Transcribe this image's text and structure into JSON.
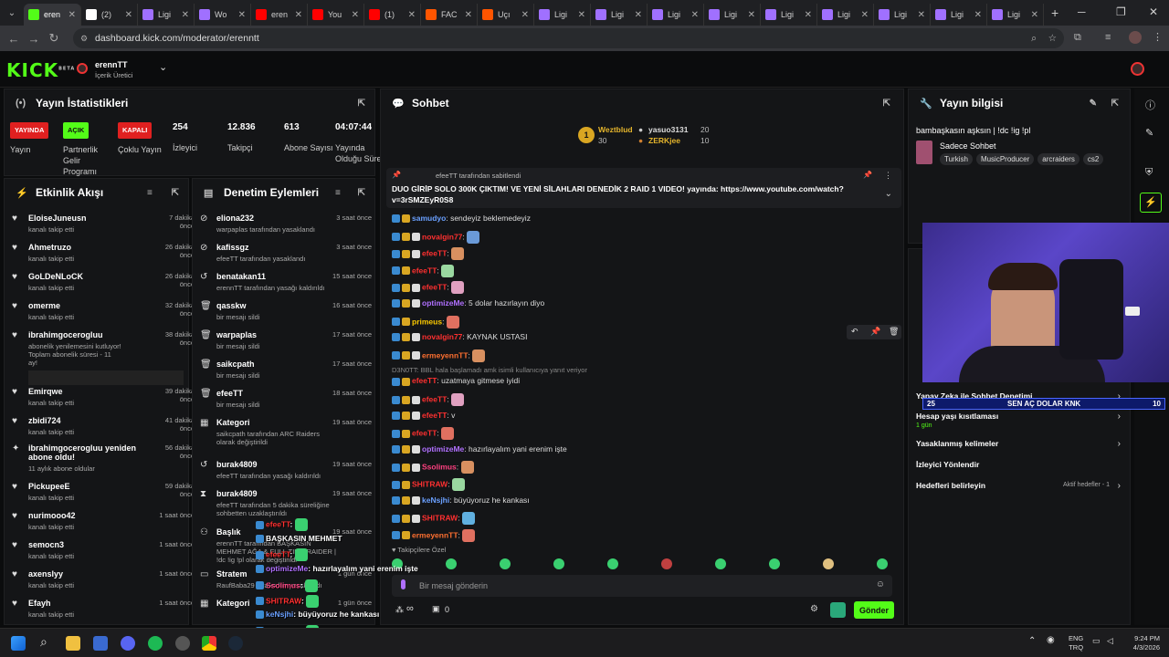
{
  "tabs": [
    {
      "label": "eren",
      "color": "#53fc18",
      "active": true
    },
    {
      "label": "(2)",
      "color": "#ffffff"
    },
    {
      "label": "Ligi",
      "color": "#a070ff"
    },
    {
      "label": "Wo",
      "color": "#a070ff"
    },
    {
      "label": "eren",
      "color": "#ff0000"
    },
    {
      "label": "You",
      "color": "#ff0000"
    },
    {
      "label": "(1)",
      "color": "#ff0000"
    },
    {
      "label": "FAC",
      "color": "#ff5500"
    },
    {
      "label": "Uçı",
      "color": "#ff5500"
    },
    {
      "label": "Ligi",
      "color": "#a070ff"
    },
    {
      "label": "Ligi",
      "color": "#a070ff"
    },
    {
      "label": "Ligi",
      "color": "#a070ff"
    },
    {
      "label": "Ligi",
      "color": "#a070ff"
    },
    {
      "label": "Ligi",
      "color": "#a070ff"
    },
    {
      "label": "Ligi",
      "color": "#a070ff"
    },
    {
      "label": "Ligi",
      "color": "#a070ff"
    },
    {
      "label": "Ligi",
      "color": "#a070ff"
    },
    {
      "label": "Ligi",
      "color": "#a070ff"
    }
  ],
  "browser": {
    "url": "dashboard.kick.com/moderator/erenntt"
  },
  "header": {
    "logo": "KICK",
    "beta": "BETA",
    "channel_name": "erennTT",
    "channel_role": "İçerik Üretici"
  },
  "stats": {
    "title": "Yayın İstatistikleri",
    "items": [
      {
        "badge": "YAYINDA",
        "badge_color": "#e02020",
        "label": "Yayın"
      },
      {
        "badge": "AÇIK",
        "badge_color": "#53fc18",
        "label": "Partnerlik Gelir Programı"
      },
      {
        "badge": "KAPALI",
        "badge_color": "#e02020",
        "label": "Çoklu Yayın"
      },
      {
        "value": "254",
        "label": "İzleyici"
      },
      {
        "value": "12.836",
        "label": "Takipçi"
      },
      {
        "value": "613",
        "label": "Abone Sayısı"
      },
      {
        "value": "04:07:44",
        "label": "Yayında Olduğu Süre"
      }
    ]
  },
  "activity": {
    "title": "Etkinlik Akışı",
    "items": [
      {
        "name": "EloiseJuneusn",
        "sub": "kanalı takip etti",
        "time": "7 dakika önce"
      },
      {
        "name": "Ahmetruzo",
        "sub": "kanalı takip etti",
        "time": "26 dakika önce"
      },
      {
        "name": "GoLDeNLoCK",
        "sub": "kanalı takip etti",
        "time": "26 dakika önce"
      },
      {
        "name": "omerme",
        "sub": "kanalı takip etti",
        "time": "32 dakika önce"
      },
      {
        "name": "ibrahimgocerogluu",
        "sub": "abonelik yenilemesini kutluyor! Toplam abonelik süresi - 11 ay!",
        "time": "38 dakika önce"
      },
      {
        "name": "Emirqwe",
        "sub": "kanalı takip etti",
        "time": "39 dakika önce"
      },
      {
        "name": "zbidi724",
        "sub": "kanalı takip etti",
        "time": "41 dakika önce"
      },
      {
        "name": "ibrahimgocerogluu yeniden abone oldu!",
        "sub": "11 aylık abone oldular",
        "time": "56 dakika önce"
      },
      {
        "name": "PickupeeE",
        "sub": "kanalı takip etti",
        "time": "59 dakika önce"
      },
      {
        "name": "nurimooo42",
        "sub": "kanalı takip etti",
        "time": "1 saat önce"
      },
      {
        "name": "semocn3",
        "sub": "kanalı takip etti",
        "time": "1 saat önce"
      },
      {
        "name": "axenslyy",
        "sub": "kanalı takip etti",
        "time": "1 saat önce"
      },
      {
        "name": "Efayh",
        "sub": "kanalı takip etti",
        "time": "1 saat önce"
      }
    ]
  },
  "moderation": {
    "title": "Denetim Eylemleri",
    "items": [
      {
        "name": "eliona232",
        "sub": "warpaplas tarafından yasaklandı",
        "time": "3 saat önce"
      },
      {
        "name": "kafissgz",
        "sub": "efeeTT tarafından yasaklandı",
        "time": "3 saat önce"
      },
      {
        "name": "benatakan11",
        "sub": "erennTT tarafından yasağı kaldırıldı",
        "time": "15 saat önce"
      },
      {
        "name": "qasskw",
        "sub": "bir mesajı sildi",
        "time": "16 saat önce"
      },
      {
        "name": "warpaplas",
        "sub": "bir mesajı sildi",
        "time": "17 saat önce"
      },
      {
        "name": "saikcpath",
        "sub": "bir mesajı sildi",
        "time": "17 saat önce"
      },
      {
        "name": "efeeTT",
        "sub": "bir mesajı sildi",
        "time": "18 saat önce"
      },
      {
        "name": "Kategori",
        "sub": "saikcpath tarafından ARC Raiders olarak değiştirildi",
        "time": "19 saat önce"
      },
      {
        "name": "burak4809",
        "sub": "efeeTT tarafından yasağı kaldırıldı",
        "time": "19 saat önce"
      },
      {
        "name": "burak4809",
        "sub": "efeeTT tarafından 5 dakika süreliğine sohbetten uzaklaştırıldı",
        "time": "19 saat önce"
      },
      {
        "name": "Başlık",
        "sub": "erennTT tarafından BAŞKASIN MEHMET AĞA & FULL TIME RAIDER | !dc !ig !pl olarak değiştirildi",
        "time": "19 saat önce"
      },
      {
        "name": "Stratem",
        "sub": "RaufBaba29 tarafından yasaklandı",
        "time": "1 gün önce"
      },
      {
        "name": "Kategori",
        "sub": "",
        "time": "1 gün önce"
      }
    ]
  },
  "chat": {
    "title": "Sohbet",
    "top": [
      {
        "name": "Weztblud",
        "count": "30"
      },
      {
        "name": "yasuo3131",
        "count": "20"
      },
      {
        "name": "ZERKjee",
        "count": "10"
      }
    ],
    "pinned_by": "efeeTT tarafından sabitlendi",
    "pinned_text": "DUO GİRİP SOLO 300K ÇIKTIM! VE YENİ SİLAHLARI DENEDİK 2 RAID 1 VIDEO! yayında: https://www.youtube.com/watch?v=3rSMZEyR0S8",
    "messages": [
      {
        "user": "samudyo",
        "color": "#6aa0ff",
        "text": "sendeyiz beklemedeyiz"
      },
      {
        "user": "novalgin77",
        "color": "#ff3030",
        "text": ""
      },
      {
        "user": "efeeTT",
        "color": "#ff3030",
        "text": ""
      },
      {
        "user": "efeeTT",
        "color": "#ff3030",
        "text": ""
      },
      {
        "user": "efeeTT",
        "color": "#ff3030",
        "text": ""
      },
      {
        "user": "optimizeMe",
        "color": "#b070ff",
        "text": "5 dolar hazırlayın diyo"
      },
      {
        "user": "primeus",
        "color": "#ffcc00",
        "text": ""
      },
      {
        "user": "novalgin77",
        "color": "#ff3030",
        "text": "KAYNAK USTASI"
      },
      {
        "user": "ermeyennTT",
        "color": "#ff7030",
        "text": ""
      },
      {
        "user": "efeeTT",
        "color": "#ff3030",
        "text": "uzatmaya gitmese iyidi",
        "reply": "D3N0TT: BBL hala başlamadı amk isimli kullanıcıya yanıt veriyor"
      },
      {
        "user": "efeeTT",
        "color": "#ff3030",
        "text": ""
      },
      {
        "user": "efeeTT",
        "color": "#ff3030",
        "text": "v"
      },
      {
        "user": "efeeTT",
        "color": "#ff3030",
        "text": ""
      },
      {
        "user": "optimizeMe",
        "color": "#b070ff",
        "text": "hazırlayalım yani erenim işte"
      },
      {
        "user": "Ssolimus",
        "color": "#ff4080",
        "text": ""
      },
      {
        "user": "SHITRAW",
        "color": "#ff3030",
        "text": ""
      },
      {
        "user": "keNsjhi",
        "color": "#6aa0ff",
        "text": "büyüyoruz he kankası"
      },
      {
        "user": "SHITRAW",
        "color": "#ff3030",
        "text": ""
      },
      {
        "user": "ermeyennTT",
        "color": "#ff7030",
        "text": ""
      }
    ],
    "followers_label": "Takipçilere Özel",
    "input_placeholder": "Bir mesaj gönderin",
    "send": "Gönder",
    "counter": "0",
    "infinity": "∞"
  },
  "stream_info": {
    "title": "Yayın bilgisi",
    "stream_title": "bambaşkasın aşksın | !dc !ig !pl",
    "category": "Sadece Sohbet",
    "tags": [
      "Turkish",
      "MusicProducer",
      "arcraiders",
      "cs2"
    ]
  },
  "moderation_settings": {
    "items": [
      {
        "label": "Yapay Zeka ile Sohbet Denetimi",
        "sub": ""
      },
      {
        "label": "Hesap yaşı kısıtlaması",
        "sub": "1 gün"
      },
      {
        "label": "Yasaklanmış kelimeler",
        "sub": ""
      },
      {
        "label": "İzleyici Yönlendir",
        "sub": ""
      },
      {
        "label": "Hedefleri belirleyin",
        "sub": "Aktif hedefler - 1"
      }
    ]
  },
  "goal_bar": {
    "left": "25",
    "text": "SEN AÇ DOLAR KNK",
    "right": "10"
  },
  "overlay": [
    {
      "user": "efeeTT",
      "color": "#ff3030",
      "text": ""
    },
    {
      "user": "",
      "color": "#fff",
      "text": "BAŞKASIN MEHMET"
    },
    {
      "user": "efeeTT",
      "color": "#ff3030",
      "text": ""
    },
    {
      "user": "optimizeMe",
      "color": "#b070ff",
      "text": "hazırlayalım yani erenim işte"
    },
    {
      "user": "Ssolimus",
      "color": "#ff4080",
      "text": ""
    },
    {
      "user": "SHITRAW",
      "color": "#ff3030",
      "text": ""
    },
    {
      "user": "keNsjhi",
      "color": "#6aa0ff",
      "text": "büyüyoruz he kankası"
    },
    {
      "user": "SHITRAW",
      "color": "#ff3030",
      "text": ""
    },
    {
      "user": "ermeyennTT",
      "color": "#ff7030",
      "text": ""
    }
  ],
  "taskbar": {
    "lang1": "ENG",
    "lang2": "TRQ",
    "time": "9:24 PM",
    "date": "4/3/2026"
  }
}
